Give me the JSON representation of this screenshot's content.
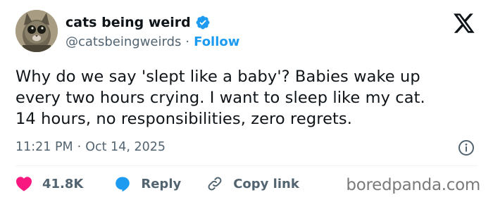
{
  "author": {
    "display_name": "cats being weird",
    "handle": "@catsbeingweirds",
    "separator": "·",
    "follow_label": "Follow",
    "verified": true
  },
  "tweet": {
    "lines": [
      "Why do we say 'slept like a baby'? Babies wake up",
      "every two hours crying. I want to sleep like my cat.",
      "14 hours, no responsibilities, zero regrets."
    ],
    "time": "11:21 PM",
    "separator": "·",
    "date": "Oct 14, 2025"
  },
  "actions": {
    "likes": "41.8K",
    "reply_label": "Reply",
    "copy_link_label": "Copy link"
  },
  "icons": [
    "verified-icon",
    "x-logo-icon",
    "info-icon",
    "heart-icon",
    "reply-bubble-icon",
    "link-icon"
  ],
  "colors": {
    "accent": "#1d9bf0",
    "like": "#f91880",
    "muted": "#536471",
    "text": "#0f1419"
  },
  "watermark": "boredpanda.com"
}
